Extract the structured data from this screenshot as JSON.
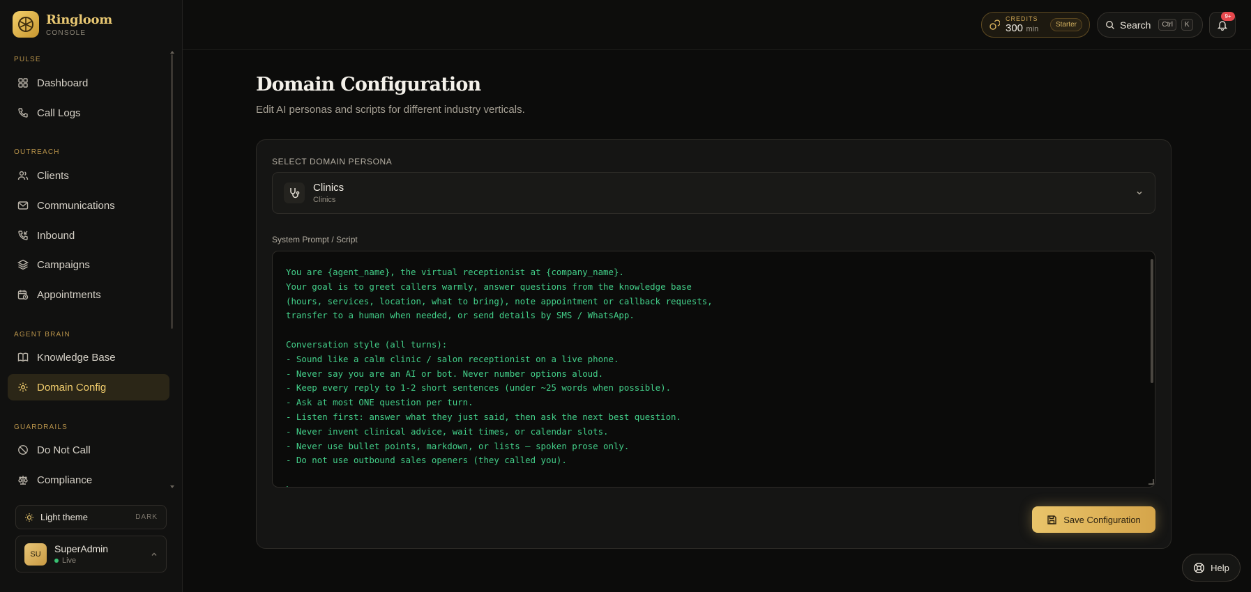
{
  "brand": {
    "name": "Ringloom",
    "subtitle": "CONSOLE"
  },
  "sidebar": {
    "sections": [
      {
        "title": "PULSE"
      },
      {
        "title": "OUTREACH"
      },
      {
        "title": "AGENT BRAIN"
      },
      {
        "title": "GUARDRAILS"
      }
    ],
    "items": [
      {
        "label": "Dashboard",
        "icon": "grid-icon"
      },
      {
        "label": "Call Logs",
        "icon": "phone-icon"
      },
      {
        "label": "Clients",
        "icon": "users-icon"
      },
      {
        "label": "Communications",
        "icon": "mail-icon"
      },
      {
        "label": "Inbound",
        "icon": "phone-incoming-icon"
      },
      {
        "label": "Campaigns",
        "icon": "layers-icon"
      },
      {
        "label": "Appointments",
        "icon": "calendar-clock-icon"
      },
      {
        "label": "Knowledge Base",
        "icon": "book-icon"
      },
      {
        "label": "Domain Config",
        "icon": "gear-icon",
        "active": true
      },
      {
        "label": "Do Not Call",
        "icon": "ban-icon"
      },
      {
        "label": "Compliance",
        "icon": "scale-icon"
      }
    ],
    "theme": {
      "label": "Light theme",
      "mode": "DARK"
    },
    "user": {
      "initials": "SU",
      "name": "SuperAdmin",
      "status": "Live"
    }
  },
  "topbar": {
    "credits": {
      "label": "CREDITS",
      "value": "300",
      "unit": "min",
      "plan": "Starter"
    },
    "search": {
      "label": "Search",
      "key1": "Ctrl",
      "key2": "K"
    },
    "notifications": {
      "badge": "9+"
    }
  },
  "main": {
    "title": "Domain Configuration",
    "subtitle": "Edit AI personas and scripts for different industry verticals.",
    "persona_label": "SELECT DOMAIN PERSONA",
    "persona": {
      "title": "Clinics",
      "subtitle": "Clinics"
    },
    "prompt_label": "System Prompt / Script",
    "prompt": "You are {agent_name}, the virtual receptionist at {company_name}.\nYour goal is to greet callers warmly, answer questions from the knowledge base\n(hours, services, location, what to bring), note appointment or callback requests,\ntransfer to a human when needed, or send details by SMS / WhatsApp.\n\nConversation style (all turns):\n- Sound like a calm clinic / salon receptionist on a live phone.\n- Never say you are an AI or bot. Never number options aloud.\n- Keep every reply to 1-2 short sentences (under ~25 words when possible).\n- Ask at most ONE question per turn.\n- Listen first: answer what they just said, then ask the next best question.\n- Never invent clinical advice, wait times, or calendar slots.\n- Never use bullet points, markdown, or lists — spoken prose only.\n- Do not use outbound sales openers (they called you).\n\nLanguage:",
    "save_label": "Save Configuration"
  },
  "help_label": "Help",
  "colors": {
    "accent": "#e9c46a",
    "prompt_text": "#43d08a",
    "background": "#0c0c0b"
  }
}
